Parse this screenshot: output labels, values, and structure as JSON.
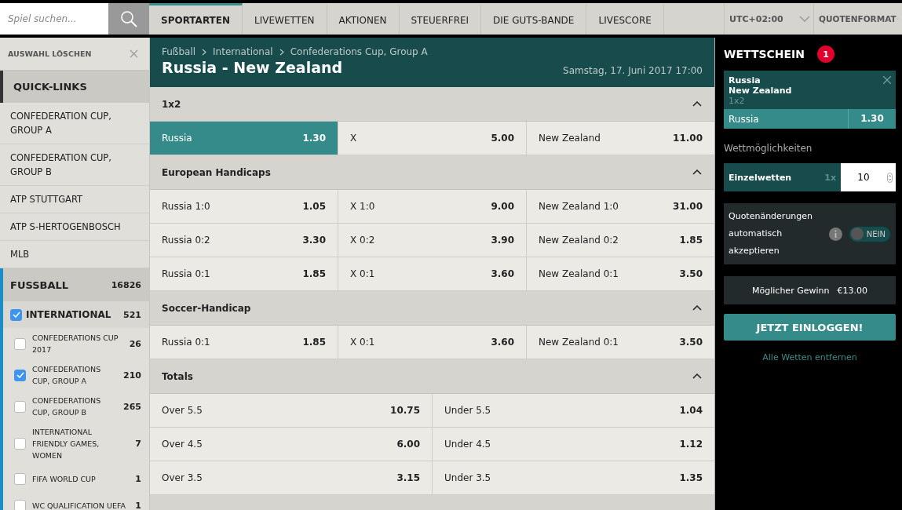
{
  "search": {
    "placeholder": "Spiel suchen..."
  },
  "nav": [
    {
      "label": "SPORTARTEN",
      "selected": true
    },
    {
      "label": "LIVEWETTEN",
      "selected": false
    },
    {
      "label": "AKTIONEN",
      "selected": false
    },
    {
      "label": "STEUERFREI",
      "selected": false
    },
    {
      "label": "DIE GUTS-BANDE",
      "selected": false
    },
    {
      "label": "LIVESCORE",
      "selected": false
    }
  ],
  "timezone": "UTC+02:00",
  "odds_format": "QUOTENFORMAT",
  "sidebar": {
    "clear": "AUSWAHL LÖSCHEN",
    "quick_links_title": "QUICK-LINKS",
    "quick_links": [
      "CONFEDERATION CUP, GROUP A",
      "CONFEDERATION CUP, GROUP B",
      "ATP STUTTGART",
      "ATP S-HERTOGENBOSCH",
      "MLB"
    ],
    "sport": {
      "name": "FUSSBALL",
      "count": "16826"
    },
    "category": {
      "name": "INTERNATIONAL",
      "count": "521",
      "checked": true
    },
    "leagues": [
      {
        "name": "CONFEDERATIONS CUP 2017",
        "count": "26",
        "checked": false
      },
      {
        "name": "CONFEDERATIONS CUP, GROUP A",
        "count": "210",
        "checked": true
      },
      {
        "name": "CONFEDERATIONS CUP, GROUP B",
        "count": "265",
        "checked": false
      },
      {
        "name": "INTERNATIONAL FRIENDLY GAMES, WOMEN",
        "count": "7",
        "checked": false
      },
      {
        "name": "FIFA WORLD CUP",
        "count": "1",
        "checked": false
      },
      {
        "name": "WC QUALIFICATION UEFA",
        "count": "1",
        "checked": false
      }
    ]
  },
  "event": {
    "breadcrumb": [
      "Fußball",
      "International",
      "Confederations Cup, Group A"
    ],
    "title": "Russia - New Zealand",
    "date": "Samstag, 17. Juni 2017 17:00"
  },
  "markets": [
    {
      "title": "1x2",
      "expanded": true,
      "rows": [
        [
          {
            "label": "Russia",
            "odds": "1.30",
            "selected": true
          },
          {
            "label": "X",
            "odds": "5.00",
            "selected": false
          },
          {
            "label": "New Zealand",
            "odds": "11.00",
            "selected": false
          }
        ]
      ]
    },
    {
      "title": "European Handicaps",
      "expanded": true,
      "rows": [
        [
          {
            "label": "Russia 1:0",
            "odds": "1.05",
            "selected": false
          },
          {
            "label": "X 1:0",
            "odds": "9.00",
            "selected": false
          },
          {
            "label": "New Zealand 1:0",
            "odds": "31.00",
            "selected": false
          }
        ],
        [
          {
            "label": "Russia 0:2",
            "odds": "3.30",
            "selected": false
          },
          {
            "label": "X 0:2",
            "odds": "3.90",
            "selected": false
          },
          {
            "label": "New Zealand 0:2",
            "odds": "1.85",
            "selected": false
          }
        ],
        [
          {
            "label": "Russia 0:1",
            "odds": "1.85",
            "selected": false
          },
          {
            "label": "X 0:1",
            "odds": "3.60",
            "selected": false
          },
          {
            "label": "New Zealand 0:1",
            "odds": "3.50",
            "selected": false
          }
        ]
      ]
    },
    {
      "title": "Soccer-Handicap",
      "expanded": true,
      "rows": [
        [
          {
            "label": "Russia 0:1",
            "odds": "1.85",
            "selected": false
          },
          {
            "label": "X 0:1",
            "odds": "3.60",
            "selected": false
          },
          {
            "label": "New Zealand 0:1",
            "odds": "3.50",
            "selected": false
          }
        ]
      ]
    },
    {
      "title": "Totals",
      "expanded": true,
      "rows": [
        [
          {
            "label": "Over 5.5",
            "odds": "10.75",
            "selected": false
          },
          {
            "label": "Under 5.5",
            "odds": "1.04",
            "selected": false
          }
        ],
        [
          {
            "label": "Over 4.5",
            "odds": "6.00",
            "selected": false
          },
          {
            "label": "Under 4.5",
            "odds": "1.12",
            "selected": false
          }
        ],
        [
          {
            "label": "Over 3.5",
            "odds": "3.15",
            "selected": false
          },
          {
            "label": "Under 3.5",
            "odds": "1.35",
            "selected": false
          }
        ]
      ]
    }
  ],
  "betslip": {
    "title": "WETTSCHEIN",
    "count": "1",
    "bet": {
      "home": "Russia",
      "away": "New Zealand",
      "market": "1x2",
      "pick": "Russia",
      "odds": "1.30"
    },
    "options_label": "Wettmöglichkeiten",
    "single": {
      "label": "Einzelwetten",
      "multiplier": "1x",
      "stake": "10"
    },
    "auto_accept": {
      "label": "Quotenänderungen automatisch akzeptieren",
      "on": false,
      "toggle_label": "NEIN"
    },
    "win": {
      "label": "Möglicher Gewinn",
      "amount": "€13.00"
    },
    "login": "JETZT EINLOGGEN!",
    "remove_all": "Alle Wetten entfernen"
  }
}
